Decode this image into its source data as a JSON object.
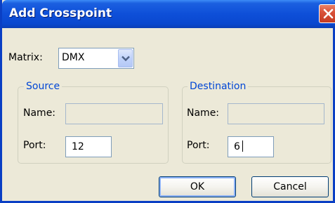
{
  "window": {
    "title": "Add Crosspoint"
  },
  "matrix": {
    "label": "Matrix:",
    "value": "DMX"
  },
  "source": {
    "legend": "Source",
    "name_label": "Name:",
    "name_value": "",
    "port_label": "Port:",
    "port_value": "12"
  },
  "destination": {
    "legend": "Destination",
    "name_label": "Name:",
    "name_value": "",
    "port_label": "Port:",
    "port_value": "6"
  },
  "buttons": {
    "ok": "OK",
    "cancel": "Cancel"
  },
  "icons": {
    "close": "close-icon",
    "dropdown": "chevron-down-icon"
  },
  "colors": {
    "titlebar": "#0a48cf",
    "group_legend": "#0046d5",
    "close_button": "#d9523a"
  }
}
